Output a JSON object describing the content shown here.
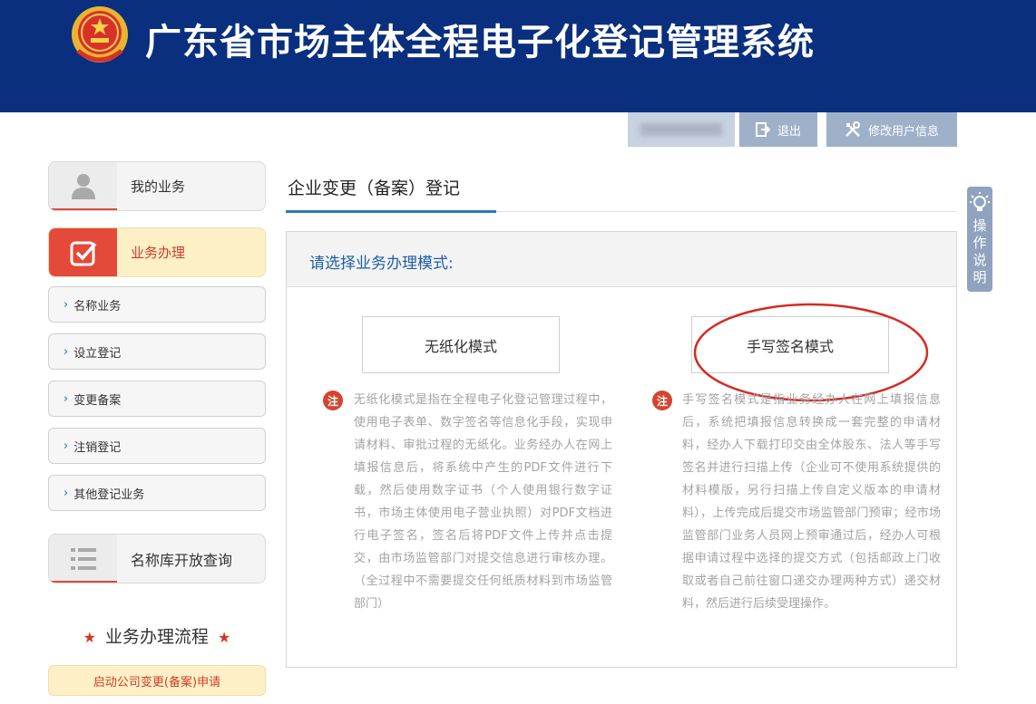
{
  "header": {
    "title": "广东省市场主体全程电子化登记管理系统",
    "bg_color": "#0a2f7e"
  },
  "userbar": {
    "logout_label": "退出",
    "edit_profile_label": "修改用户信息"
  },
  "sidebar": {
    "cards": [
      {
        "label": "我的业务",
        "icon": "user-icon"
      },
      {
        "label": "业务办理",
        "icon": "checkbox-icon"
      },
      {
        "label": "名称库开放查询",
        "icon": "list-icon"
      }
    ],
    "sub_items": [
      {
        "label": "名称业务"
      },
      {
        "label": "设立登记"
      },
      {
        "label": "变更备案"
      },
      {
        "label": "注销登记"
      },
      {
        "label": "其他登记业务"
      }
    ],
    "flow_title": "业务办理流程",
    "flow_button": "启动公司变更(备案)申请"
  },
  "main": {
    "page_title": "企业变更（备案）登记",
    "panel_heading": "请选择业务办理模式:",
    "modes": [
      {
        "label": "无纸化模式",
        "note_badge": "注",
        "note": "无纸化模式是指在全程电子化登记管理过程中，使用电子表单、数字签名等信息化手段，实现申请材料、审批过程的无纸化。业务经办人在网上填报信息后，将系统中产生的PDF文件进行下载，然后使用数字证书（个人使用银行数字证书，市场主体使用电子营业执照）对PDF文档进行电子签名，签名后将PDF文件上传并点击提交，由市场监管部门对提交信息进行审核办理。（全过程中不需要提交任何纸质材料到市场监管部门）"
      },
      {
        "label": "手写签名模式",
        "note_badge": "注",
        "note": "手写签名模式是指业务经办人在网上填报信息后，系统把填报信息转换成一套完整的申请材料，经办人下载打印交由全体股东、法人等手写签名并进行扫描上传（企业可不使用系统提供的材料模版，另行扫描上传自定义版本的申请材料），上传完成后提交市场监管部门预审；经市场监管部门业务人员网上预审通过后，经办人可根据申请过程中选择的提交方式（包括邮政上门收取或者自己前往窗口递交办理两种方式）递交材料，然后进行后续受理操作。"
      }
    ]
  },
  "help_tab": {
    "label": "操\n作\n说\n明",
    "icon": "lightbulb-icon"
  },
  "colors": {
    "accent_red": "#d4452f",
    "link_blue": "#1d5fa3",
    "highlight_ellipse": "#d42a22"
  }
}
